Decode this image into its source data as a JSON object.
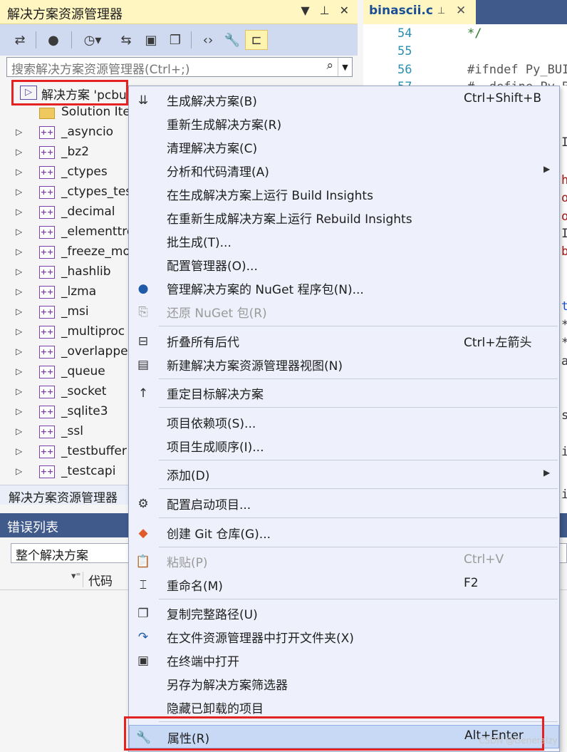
{
  "solution_explorer": {
    "title": "解决方案资源管理器",
    "title_buttons": [
      "▼",
      "⊥",
      "✕"
    ],
    "toolbar_icons": [
      "vs-switch-icon",
      "refresh-icon",
      "history-icon",
      "sync-icon",
      "collapse-icon",
      "copy-icon",
      "code-icon",
      "wrench-icon",
      "preview-icon"
    ],
    "search_placeholder": "搜索解决方案资源管理器(Ctrl+;)",
    "root_label": "解决方案 'pcbu",
    "items": [
      {
        "label": "Solution Ite",
        "icon": "folder-icon"
      },
      {
        "label": "_asyncio"
      },
      {
        "label": "_bz2"
      },
      {
        "label": "_ctypes"
      },
      {
        "label": "_ctypes_tes"
      },
      {
        "label": "_decimal"
      },
      {
        "label": "_elementtre"
      },
      {
        "label": "_freeze_mo"
      },
      {
        "label": "_hashlib"
      },
      {
        "label": "_lzma"
      },
      {
        "label": "_msi"
      },
      {
        "label": "_multiproc"
      },
      {
        "label": "_overlappe"
      },
      {
        "label": "_queue"
      },
      {
        "label": "_socket"
      },
      {
        "label": "_sqlite3"
      },
      {
        "label": "_ssl"
      },
      {
        "label": "_testbuffer"
      },
      {
        "label": "_testcapi"
      }
    ],
    "footer_title": "解决方案资源管理器"
  },
  "error_list": {
    "title": "错误列表",
    "scope": "整个解决方案",
    "column_code": "代码"
  },
  "editor": {
    "tab_title": "binascii.c",
    "tab_pin": "⊥",
    "tab_close": "✕",
    "lines": [
      {
        "num": "54",
        "code": "*/"
      },
      {
        "num": "55",
        "code": ""
      },
      {
        "num": "56",
        "code": "#ifndef Py_BUI"
      },
      {
        "num": "57",
        "code": "#  define Py_B"
      }
    ],
    "fragments": [
      "I",
      "h",
      "o",
      "o",
      "I",
      "b",
      "t",
      "*",
      "*",
      "a",
      "s",
      "i",
      "i"
    ]
  },
  "context_menu": {
    "items": [
      {
        "label": "生成解决方案(B)",
        "shortcut": "Ctrl+Shift+B",
        "icon": "build-icon"
      },
      {
        "label": "重新生成解决方案(R)"
      },
      {
        "label": "清理解决方案(C)"
      },
      {
        "label": "分析和代码清理(A)",
        "submenu": "▶"
      },
      {
        "label": "在生成解决方案上运行 Build Insights"
      },
      {
        "label": "在重新生成解决方案上运行 Rebuild Insights"
      },
      {
        "label": "批生成(T)..."
      },
      {
        "label": "配置管理器(O)..."
      },
      {
        "label": "管理解决方案的 NuGet 程序包(N)...",
        "icon": "nuget-icon"
      },
      {
        "label": "还原 NuGet 包(R)",
        "icon": "restore-icon",
        "disabled": true
      },
      {
        "label": "折叠所有后代",
        "shortcut": "Ctrl+左箭头",
        "icon": "collapse-all-icon"
      },
      {
        "label": "新建解决方案资源管理器视图(N)",
        "icon": "new-view-icon"
      },
      {
        "label": "重定目标解决方案",
        "icon": "arrow-up-icon"
      },
      {
        "label": "项目依赖项(S)..."
      },
      {
        "label": "项目生成顺序(I)..."
      },
      {
        "label": "添加(D)",
        "submenu": "▶"
      },
      {
        "label": "配置启动项目...",
        "icon": "gear-icon"
      },
      {
        "label": "创建 Git 仓库(G)...",
        "icon": "git-icon"
      },
      {
        "label": "粘贴(P)",
        "shortcut": "Ctrl+V",
        "icon": "paste-icon",
        "disabled": true
      },
      {
        "label": "重命名(M)",
        "shortcut": "F2",
        "icon": "rename-icon"
      },
      {
        "label": "复制完整路径(U)",
        "icon": "copy-path-icon"
      },
      {
        "label": "在文件资源管理器中打开文件夹(X)",
        "icon": "open-folder-icon"
      },
      {
        "label": "在终端中打开",
        "icon": "terminal-icon"
      },
      {
        "label": "另存为解决方案筛选器"
      },
      {
        "label": "隐藏已卸载的项目"
      },
      {
        "label": "属性(R)",
        "shortcut": "Alt+Enter",
        "icon": "wrench-icon",
        "highlighted": true
      }
    ]
  },
  "watermark": "CSDN @Generalzy",
  "colors": {
    "accent_title": "#fff6c1",
    "menu_background": "#eef1fb",
    "highlight": "#c8d9f5",
    "annotation": "#e52222"
  }
}
